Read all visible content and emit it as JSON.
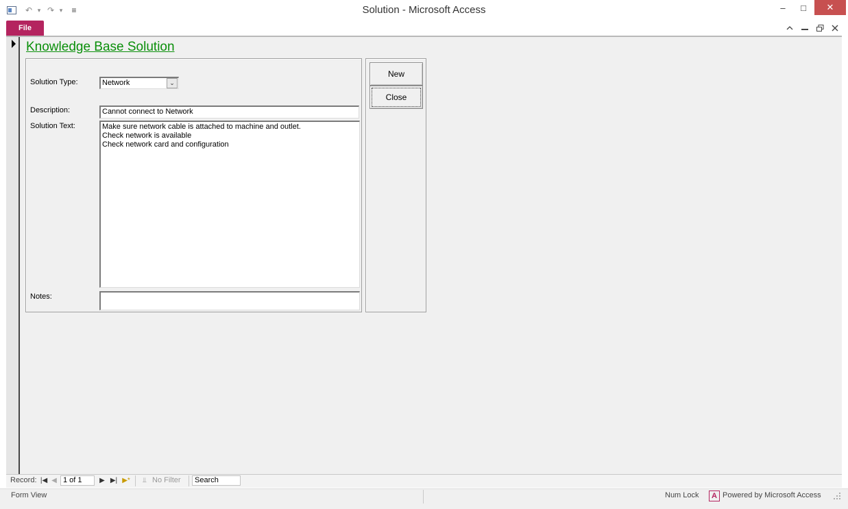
{
  "window": {
    "title": "Solution  -  Microsoft Access",
    "file_tab": "File",
    "minimize": "–",
    "maximize": "□",
    "close": "✕"
  },
  "qat": {
    "undo": "↶",
    "redo": "↷",
    "dropdown": "▾",
    "customize": "≡"
  },
  "form": {
    "title": "Knowledge Base Solution",
    "solution_type_label": "Solution Type:",
    "solution_type_value": "Network",
    "dropdown_arrow": "⌄",
    "description_label": "Description:",
    "description_value": "Cannot connect to Network",
    "solution_text_label": "Solution Text:",
    "solution_text_value": "Make sure network cable is attached to machine and outlet.\nCheck network is available\nCheck network card and configuration",
    "notes_label": "Notes:",
    "notes_value": "",
    "new_button": "New",
    "close_button": "Close"
  },
  "navigation": {
    "record_label": "Record:",
    "first": "|◀",
    "prev": "◀",
    "record_value": "1 of 1",
    "next": "▶",
    "last": "▶|",
    "new_record": "▶*",
    "no_filter": "No Filter",
    "filter_icon": "⫫",
    "search_value": "Search"
  },
  "status": {
    "view": "Form View",
    "num_lock": "Num Lock",
    "access_icon_letter": "A",
    "powered_by": "Powered by Microsoft Access"
  },
  "colors": {
    "title_green": "#0a8f0a",
    "file_tab": "#b4245f",
    "form_background": "#f0f0f0"
  }
}
